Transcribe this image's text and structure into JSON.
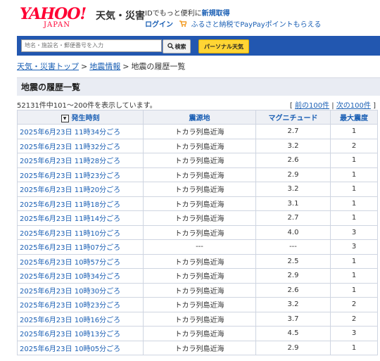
{
  "header": {
    "logo_main": "YAHOO!",
    "logo_sub": "JAPAN",
    "service": "天気・災害",
    "id_text": "IDでもっと便利に",
    "register": "新規取得",
    "login": "ログイン",
    "furusato": "ふるさと納税でPayPayポイントもらえる"
  },
  "search": {
    "placeholder": "地名・施設名・郵便番号を入力",
    "button": "検索",
    "personal": "パーソナル天気"
  },
  "breadcrumb": {
    "home": "天気・災害トップ",
    "quake_info": "地震情報",
    "current": "地震の履歴一覧",
    "sep": ">"
  },
  "section_title": "地震の履歴一覧",
  "count_text": "52131件中101～200件を表示しています。",
  "pager": {
    "open": "[",
    "prev": "前の100件",
    "divider": "|",
    "next": "次の100件",
    "close": "]"
  },
  "table": {
    "headers": [
      "発生時刻",
      "震源地",
      "マグニチュード",
      "最大震度"
    ],
    "rows": [
      {
        "time": "2025年6月23日 11時34分ごろ",
        "place": "トカラ列島近海",
        "mag": "2.7",
        "int": "1"
      },
      {
        "time": "2025年6月23日 11時32分ごろ",
        "place": "トカラ列島近海",
        "mag": "3.2",
        "int": "2"
      },
      {
        "time": "2025年6月23日 11時28分ごろ",
        "place": "トカラ列島近海",
        "mag": "2.6",
        "int": "1"
      },
      {
        "time": "2025年6月23日 11時23分ごろ",
        "place": "トカラ列島近海",
        "mag": "2.9",
        "int": "1"
      },
      {
        "time": "2025年6月23日 11時20分ごろ",
        "place": "トカラ列島近海",
        "mag": "3.2",
        "int": "1"
      },
      {
        "time": "2025年6月23日 11時18分ごろ",
        "place": "トカラ列島近海",
        "mag": "3.1",
        "int": "1"
      },
      {
        "time": "2025年6月23日 11時14分ごろ",
        "place": "トカラ列島近海",
        "mag": "2.7",
        "int": "1"
      },
      {
        "time": "2025年6月23日 11時10分ごろ",
        "place": "トカラ列島近海",
        "mag": "4.0",
        "int": "3"
      },
      {
        "time": "2025年6月23日 11時07分ごろ",
        "place": "---",
        "mag": "---",
        "int": "3"
      },
      {
        "time": "2025年6月23日 10時57分ごろ",
        "place": "トカラ列島近海",
        "mag": "2.5",
        "int": "1"
      },
      {
        "time": "2025年6月23日 10時34分ごろ",
        "place": "トカラ列島近海",
        "mag": "2.9",
        "int": "1"
      },
      {
        "time": "2025年6月23日 10時30分ごろ",
        "place": "トカラ列島近海",
        "mag": "2.6",
        "int": "1"
      },
      {
        "time": "2025年6月23日 10時23分ごろ",
        "place": "トカラ列島近海",
        "mag": "3.2",
        "int": "2"
      },
      {
        "time": "2025年6月23日 10時16分ごろ",
        "place": "トカラ列島近海",
        "mag": "3.7",
        "int": "2"
      },
      {
        "time": "2025年6月23日 10時13分ごろ",
        "place": "トカラ列島近海",
        "mag": "4.5",
        "int": "3"
      },
      {
        "time": "2025年6月23日 10時05分ごろ",
        "place": "トカラ列島近海",
        "mag": "2.9",
        "int": "1"
      }
    ]
  },
  "colors": {
    "brand_red": "#ff0033",
    "search_bar_blue": "#2257b0",
    "link_blue": "#1a5fb4",
    "personal_yellow": "#ffd534"
  },
  "icons": [
    "magnifier-icon",
    "cart-icon",
    "sort-desc-icon"
  ]
}
